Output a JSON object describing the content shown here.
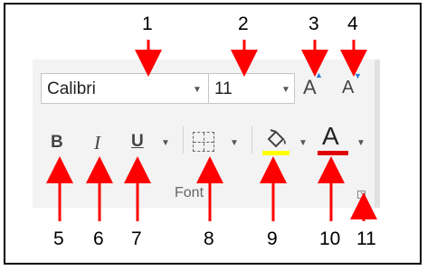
{
  "font_group": {
    "font_name": "Calibri",
    "font_size": "11",
    "label": "Font",
    "grow_font_icon": "A",
    "shrink_font_icon": "A",
    "bold_icon": "B",
    "italic_icon": "I",
    "underline_icon": "U",
    "font_color_icon": "A",
    "fill_color": "#ffff00",
    "font_color": "#e00000"
  },
  "callouts": [
    "1",
    "2",
    "3",
    "4",
    "5",
    "6",
    "7",
    "8",
    "9",
    "10",
    "11"
  ],
  "arrow_color": "#ff0000"
}
